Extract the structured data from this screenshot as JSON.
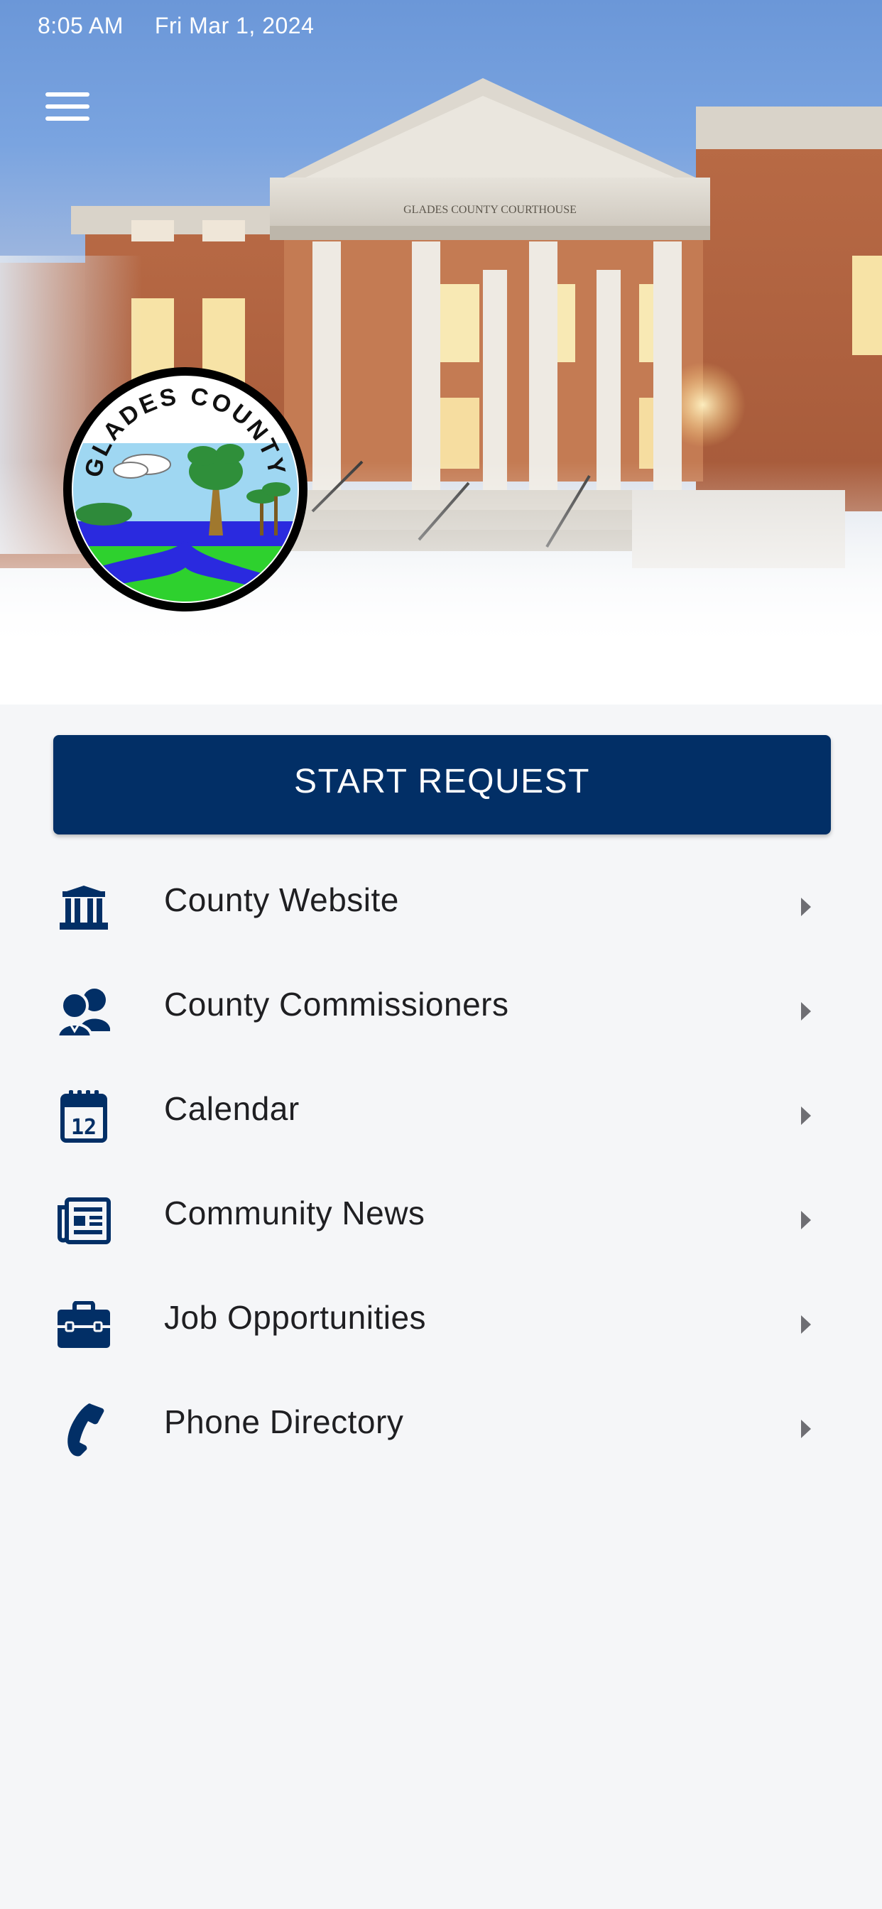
{
  "status_bar": {
    "time": "8:05 AM",
    "date": "Fri Mar 1, 2024"
  },
  "header": {
    "menu_icon": "hamburger-menu-icon",
    "logo_text": "GLADES COUNTY",
    "building_sign": "GLADES COUNTY COURTHOUSE"
  },
  "primary_action": {
    "label": "START REQUEST"
  },
  "menu_items": [
    {
      "label": "County Website",
      "icon": "building-icon"
    },
    {
      "label": "County Commissioners",
      "icon": "people-icon"
    },
    {
      "label": "Calendar",
      "icon": "calendar-icon"
    },
    {
      "label": "Community News",
      "icon": "newspaper-icon"
    },
    {
      "label": "Job Opportunities",
      "icon": "briefcase-icon"
    },
    {
      "label": "Phone Directory",
      "icon": "phone-icon"
    }
  ],
  "colors": {
    "primary": "#022f66",
    "icon": "#022f66",
    "background": "#f5f6f8",
    "chevron": "#6e6e73"
  }
}
